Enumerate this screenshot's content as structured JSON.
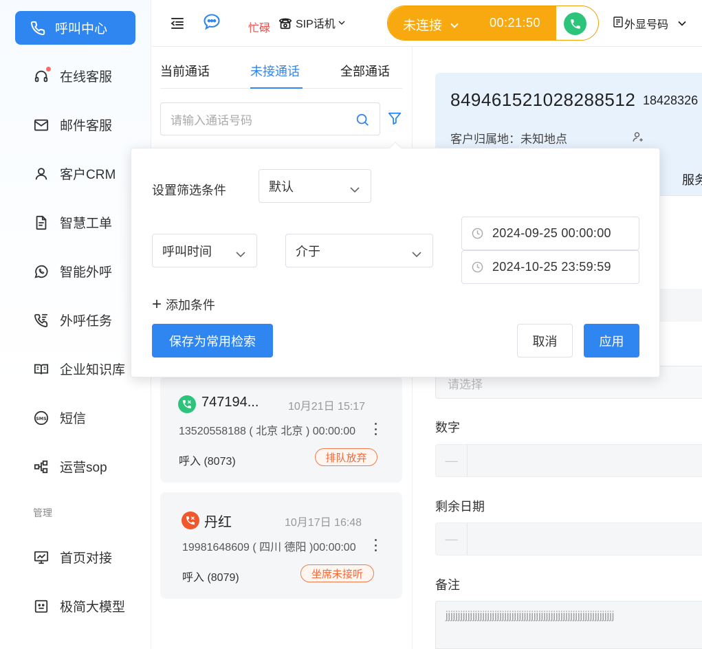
{
  "sidebar": {
    "active": {
      "label": "呼叫中心",
      "icon": "phone-icon"
    },
    "items": [
      {
        "label": "在线客服",
        "icon": "headset-icon",
        "badge": true
      },
      {
        "label": "邮件客服",
        "icon": "mail-icon"
      },
      {
        "label": "客户CRM",
        "icon": "user-icon"
      },
      {
        "label": "智慧工单",
        "icon": "document-icon"
      },
      {
        "label": "智能外呼",
        "icon": "whatsapp-icon"
      },
      {
        "label": "外呼任务",
        "icon": "phone-outgoing-icon"
      },
      {
        "label": "企业知识库",
        "icon": "book-icon"
      },
      {
        "label": "短信",
        "icon": "sms-icon"
      },
      {
        "label": "运营sop",
        "icon": "flow-icon"
      }
    ],
    "section_label": "管理",
    "manage_items": [
      {
        "label": "首页对接",
        "icon": "monitor-chart-icon"
      },
      {
        "label": "极简大模型",
        "icon": "robot-icon"
      }
    ]
  },
  "topbar": {
    "status": "忙碌",
    "sip": "SIP话机",
    "call_state": "未连接",
    "timer": "00:21:50",
    "caller_id": "外显号码"
  },
  "calls": {
    "tabs": [
      "当前通话",
      "未接通话",
      "全部通话"
    ],
    "active_tab": 1,
    "search_placeholder": "请输入通话号码",
    "cards": [
      {
        "name": "747194...",
        "time": "10月21日 15:17",
        "detail": "13520558188 ( 北京 北京 )  00:00:00",
        "direction": "呼入 (8073)",
        "tag": "排队放弃",
        "avatar_color": "#2bc47a"
      },
      {
        "name": "丹红",
        "time": "10月17日 16:48",
        "detail": "19981648609 ( 四川 德阳 )00:00:00",
        "direction": "呼入 (8079)",
        "tag": "坐席未接听",
        "avatar_color": "#f0572d"
      }
    ]
  },
  "customer": {
    "number": "849461521028288512",
    "number2": "18428326",
    "location_label": "客户归属地：未知地点",
    "tab_partial": "服务",
    "select_placeholder": "请选择",
    "field_number_label": "数字",
    "field_days_label": "剩余日期",
    "field_note_label": "备注",
    "note_value": "jjjjjjjjjjjjjjjjjjjjjjjjjjjjjjjjjjjjjjjjjjjjjjjjjjjjjjjjjjjjjjjjjjjjj"
  },
  "filter_popup": {
    "title": "设置筛选条件",
    "preset": "默认",
    "field": "呼叫时间",
    "operator": "介于",
    "date_start": "2024-09-25 00:00:00",
    "date_end": "2024-10-25 23:59:59",
    "add_condition": "添加条件",
    "save_button": "保存为常用检索",
    "cancel_button": "取消",
    "apply_button": "应用"
  }
}
